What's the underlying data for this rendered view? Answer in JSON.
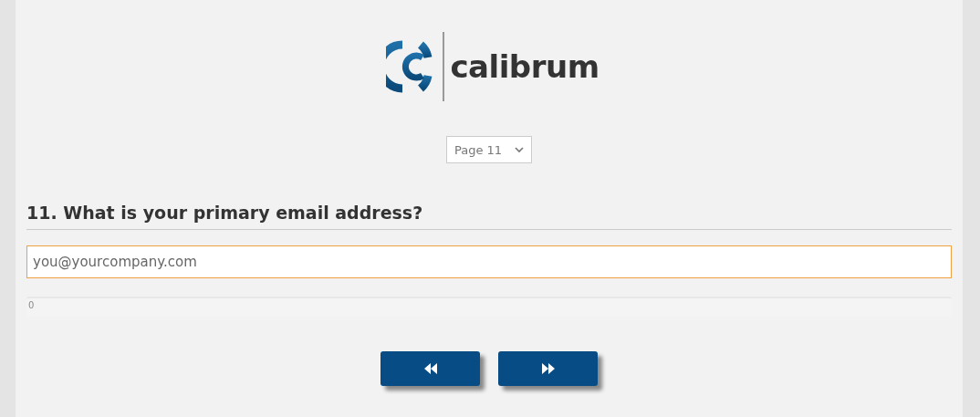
{
  "logo": {
    "text": "calibrum"
  },
  "page_select": {
    "value": "Page 11"
  },
  "question": {
    "title": "11. What is your primary email address?",
    "placeholder": "you@yourcompany.com"
  },
  "progress": {
    "level": 0,
    "label": "0"
  },
  "buttons": [
    {
      "kind": "previous"
    },
    {
      "kind": "next"
    }
  ]
}
